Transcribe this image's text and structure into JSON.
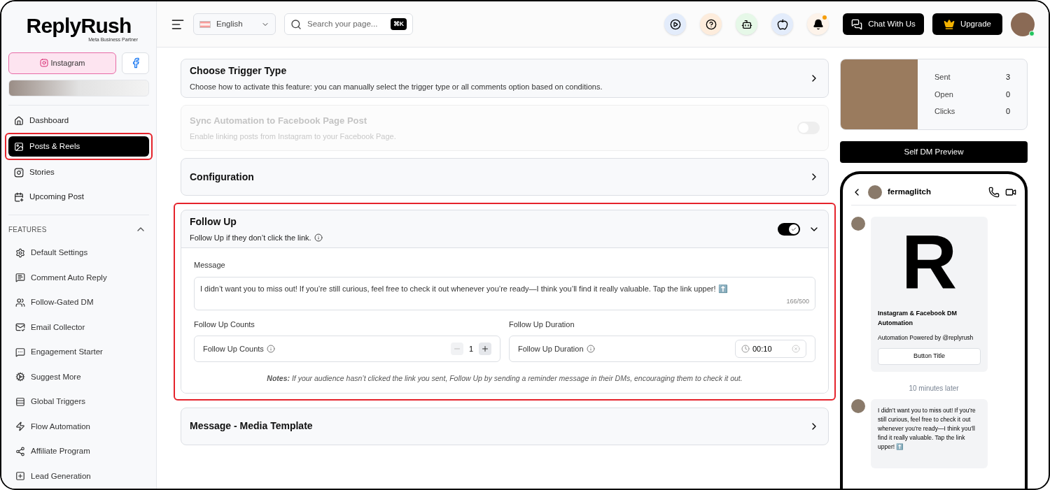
{
  "brand": {
    "name": "ReplyRush",
    "tagline": "Meta Business Partner"
  },
  "platforms": [
    {
      "label": "Instagram",
      "kind": "instagram",
      "selected": true
    },
    {
      "kind": "facebook",
      "selected": false
    }
  ],
  "nav": [
    {
      "label": "Dashboard",
      "selected": false,
      "highlighted": false
    },
    {
      "label": "Posts & Reels",
      "selected": true,
      "highlighted": true
    },
    {
      "label": "Stories",
      "selected": false,
      "highlighted": false
    },
    {
      "label": "Upcoming Post",
      "selected": false,
      "highlighted": false
    }
  ],
  "features": {
    "title": "FEATURES",
    "expanded": true,
    "items": [
      {
        "label": "Default Settings"
      },
      {
        "label": "Comment Auto Reply"
      },
      {
        "label": "Follow-Gated DM"
      },
      {
        "label": "Email Collector"
      },
      {
        "label": "Engagement Starter"
      },
      {
        "label": "Suggest More"
      },
      {
        "label": "Global Triggers"
      },
      {
        "label": "Flow Automation"
      },
      {
        "label": "Affiliate Program"
      },
      {
        "label": "Lead Generation"
      }
    ]
  },
  "header": {
    "language": "English",
    "search_placeholder": "Search your page...",
    "shortcut": "⌘K",
    "notification_dot": true,
    "chat_button": "Chat With Us",
    "upgrade_button": "Upgrade",
    "online": true
  },
  "sections": [
    {
      "kind": "link",
      "title": "Choose Trigger Type",
      "subtitle": "Choose how to activate this feature: you can manually select the trigger type or all comments option based on conditions."
    },
    {
      "kind": "toggle",
      "title": "Sync Automation to Facebook Page Post",
      "subtitle": "Enable linking posts from Instagram to your Facebook Page.",
      "disabled": true,
      "on": false
    },
    {
      "kind": "link",
      "title": "Configuration"
    },
    {
      "kind": "follow_up",
      "title": "Follow Up",
      "subtitle": "Follow Up if they don’t click the link.",
      "on": true,
      "expanded": true,
      "highlighted": true,
      "message_label": "Message",
      "message": "I didn’t want you to miss out! If you’re still curious, feel free to check it out whenever you’re ready—I think you’ll find it really valuable. Tap the link upper! ⬆️",
      "char_count": "166/500",
      "counts_heading": "Follow Up Counts",
      "counts_label": "Follow Up Counts",
      "count": "1",
      "minus_disabled": true,
      "duration_heading": "Follow Up Duration",
      "duration_label": "Follow Up Duration",
      "duration": "00:10",
      "note": "**Notes:** If your audience hasn’t clicked the link you sent, Follow Up by sending a reminder message in their DMs, encouraging them to check it out."
    },
    {
      "kind": "link",
      "title": "Message - Media Template"
    }
  ],
  "stats": [
    {
      "label": "Sent",
      "value": "3"
    },
    {
      "label": "Open",
      "value": "0"
    },
    {
      "label": "Clicks",
      "value": "0"
    }
  ],
  "preview": {
    "button": "Self DM Preview",
    "username": "fermaglitch",
    "logo_letter": "R",
    "card_title": "Instagram & Facebook DM Automation",
    "card_text": "Automation Powered by @replyrush",
    "card_button": "Button Title",
    "time": "10 minutes later",
    "message": "I didn’t want you to miss out! If you’re still curious, feel free to check it out whenever you’re ready—I think you’ll find it really valuable. Tap the link upper! ⬆️"
  }
}
